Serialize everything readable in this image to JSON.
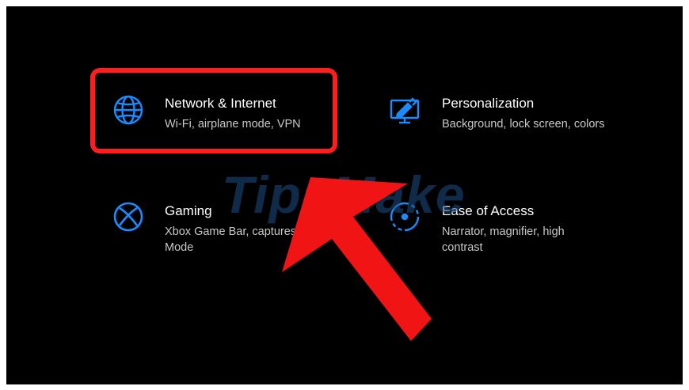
{
  "colors": {
    "background": "#000000",
    "accent": "#1a8cff",
    "highlight": "#ff1e1e",
    "title_text": "#ffffff",
    "description_text": "#c8c8c8"
  },
  "settings": {
    "network": {
      "icon": "globe-icon",
      "title": "Network & Internet",
      "description": "Wi-Fi, airplane mode, VPN"
    },
    "personalization": {
      "icon": "personalization-icon",
      "title": "Personalization",
      "description": "Background, lock screen, colors"
    },
    "gaming": {
      "icon": "xbox-icon",
      "title": "Gaming",
      "description": "Xbox Game Bar, captures, Game Mode"
    },
    "ease_of_access": {
      "icon": "ease-of-access-icon",
      "title": "Ease of Access",
      "description": "Narrator, magnifier, high contrast"
    }
  },
  "watermark": "TipsMake"
}
